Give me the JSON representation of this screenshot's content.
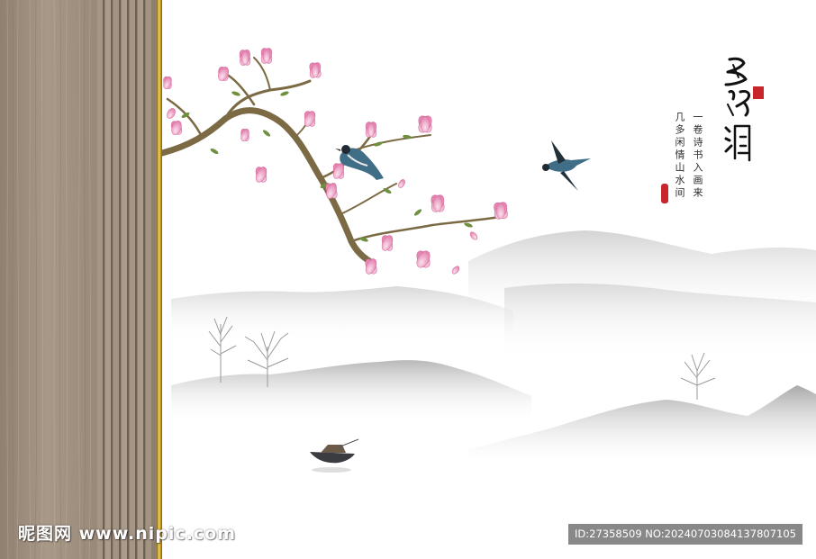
{
  "artwork": {
    "calligraphy_title": "鳥鳴澗",
    "poem_lines": [
      "一卷诗书入画来",
      "几多闲情山水间"
    ],
    "colors": {
      "wood": "#9c8c7c",
      "gold_trim": "#d8b23a",
      "blossom": "#e98bb6",
      "bird": "#3f6e86",
      "mist_mountain": "#c9c9c9",
      "seal_red": "#c8262a"
    }
  },
  "watermark": {
    "text": "昵图网 www.nipic.com",
    "id_line": "ID:27358509 NO:20240703084137807105"
  }
}
